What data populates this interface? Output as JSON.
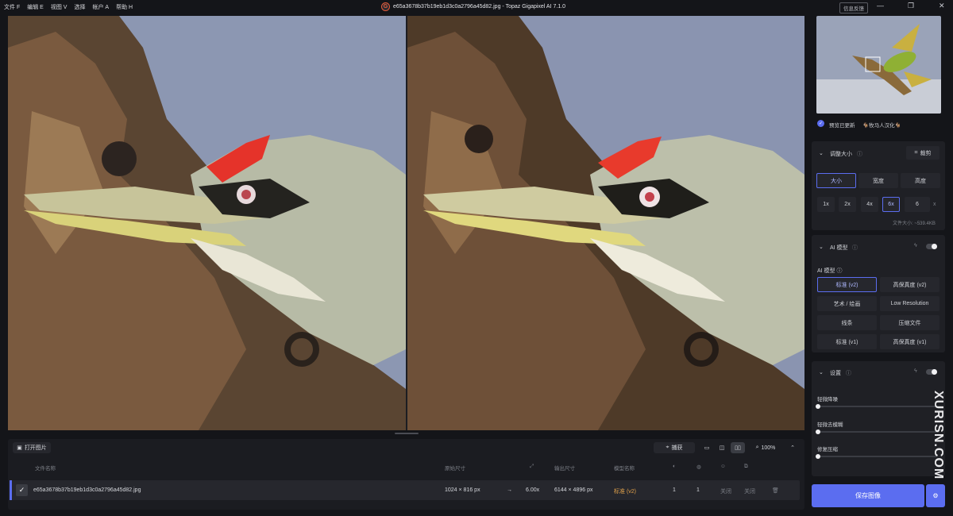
{
  "menu": [
    "文件 F",
    "编辑 E",
    "视图 V",
    "选择",
    "帐户 A",
    "帮助 H"
  ],
  "window_title": "e65a3678b37b19eb1d3c0a2796a45d82.jpg - Topaz Gigapixel AI 7.1.0",
  "feedback": "信息反馈",
  "viewer": {
    "zoom": "100%",
    "capture": "捕获"
  },
  "open_button": "打开图片",
  "table": {
    "headers": [
      "文件名称",
      "原始尺寸",
      "输出尺寸",
      "模型名称"
    ],
    "row": {
      "filename": "e65a3678b37b19eb1d3c0a2796a45d82.jpg",
      "orig_size": "1024 × 816 px",
      "scale": "6.00x",
      "out_size": "6144 × 4896 px",
      "model": "标准 (v2)",
      "v1": "1",
      "v2": "1",
      "off1": "关闭",
      "off2": "关闭"
    }
  },
  "preview": {
    "updated_label": "预览已更新",
    "credit": "🐐牧马人汉化🐐"
  },
  "resize": {
    "title": "调整大小",
    "crop": "裁剪",
    "tabs": [
      "大小",
      "宽度",
      "高度"
    ],
    "scales": [
      "1x",
      "2x",
      "4x",
      "6x"
    ],
    "custom_value": "6",
    "custom_unit": "x",
    "filesize": "文件大小: ~539.4KB"
  },
  "ai": {
    "title": "AI 模型",
    "subtitle": "AI 模型 ⓘ",
    "models": [
      "标准 (v2)",
      "高保真度 (v2)",
      "艺术 / 绘画",
      "Low Resolution",
      "线条",
      "压缩文件",
      "标准 (v1)",
      "高保真度 (v1)"
    ]
  },
  "settings": {
    "title": "设置",
    "sliders": [
      "轻微降噪",
      "轻微去模糊",
      "修复压缩"
    ]
  },
  "save_button": "保存图像",
  "watermark": "XURISN.COM",
  "colors": {
    "accent": "#5b6df0",
    "model_orange": "#e2a24b"
  }
}
